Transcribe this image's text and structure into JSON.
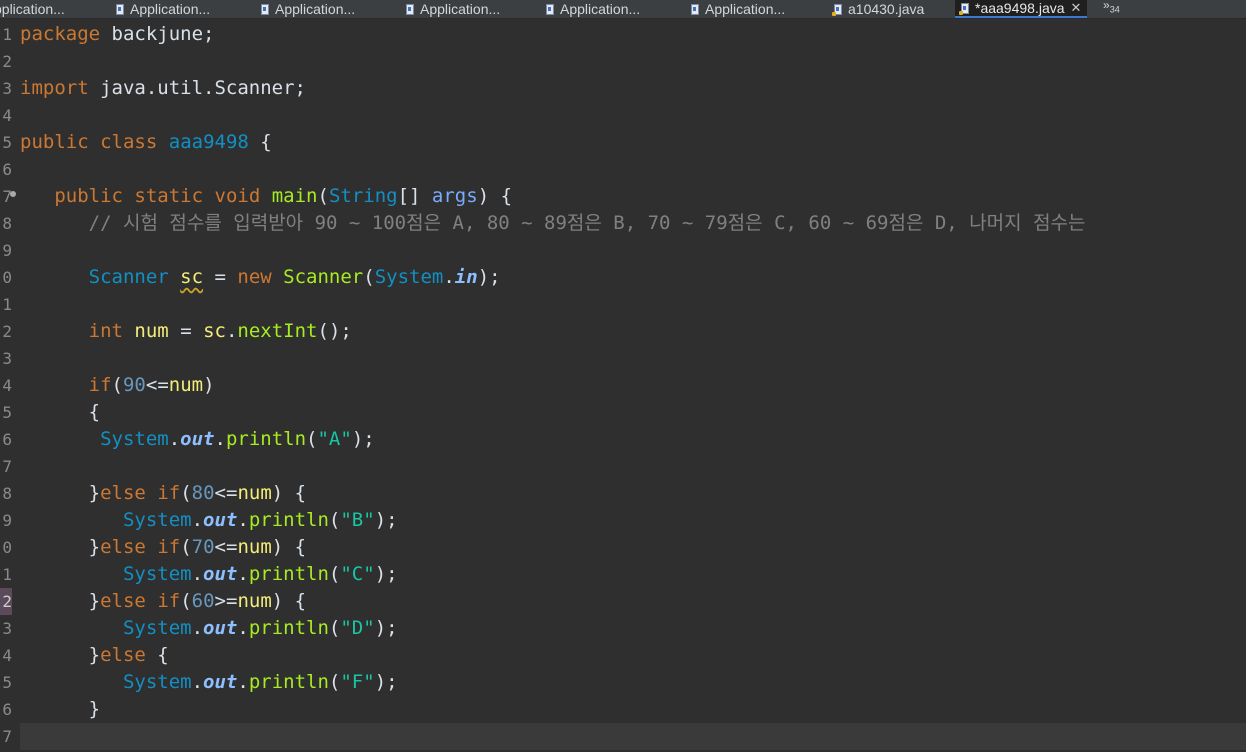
{
  "tabs": [
    {
      "label": "pplication...",
      "active": false,
      "icon": "java-file-icon"
    },
    {
      "label": "Application...",
      "active": false,
      "icon": "java-file-icon"
    },
    {
      "label": "Application...",
      "active": false,
      "icon": "java-file-icon"
    },
    {
      "label": "Application...",
      "active": false,
      "icon": "java-file-icon"
    },
    {
      "label": "Application...",
      "active": false,
      "icon": "java-file-icon"
    },
    {
      "label": "Application...",
      "active": false,
      "icon": "java-file-icon"
    },
    {
      "label": "a10430.java",
      "active": false,
      "icon": "java-file-warning-icon"
    },
    {
      "label": "*aaa9498.java",
      "active": true,
      "icon": "java-file-warning-icon",
      "close": "✕"
    }
  ],
  "overflow": {
    "chevron": "»",
    "count": "34"
  },
  "line_numbers": [
    "1",
    "2",
    "3",
    "4",
    "5",
    "6",
    "7",
    "8",
    "9",
    "0",
    "1",
    "2",
    "3",
    "4",
    "5",
    "6",
    "7",
    "8",
    "9",
    "0",
    "1",
    "2",
    "3",
    "4",
    "5",
    "6",
    "7"
  ],
  "code": {
    "l1_kw": "package",
    "l1_rest": " backjune;",
    "l3_kw": "import",
    "l3_rest": " java.util.Scanner;",
    "l5_kw1": "public",
    "l5_kw2": "class",
    "l5_name": "aaa9498",
    "l5_brace": " {",
    "l7_kw1": "public",
    "l7_kw2": "static",
    "l7_kw3": "void",
    "l7_method": "main",
    "l7_open": "(",
    "l7_type": "String",
    "l7_arr": "[] ",
    "l7_param": "args",
    "l7_close": ") {",
    "l8_comment": "// 시험 점수를 입력받아 90 ~ 100점은 A, 80 ~ 89점은 B, 70 ~ 79점은 C, 60 ~ 69점은 D, 나머지 점수는",
    "l10_type": "Scanner",
    "l10_var": "sc",
    "l10_eq": " = ",
    "l10_new": "new",
    "l10_cls": "Scanner",
    "l10_open": "(",
    "l10_sys": "System",
    "l10_dot": ".",
    "l10_in": "in",
    "l10_close": ");",
    "l12_kw": "int",
    "l12_var": "num",
    "l12_eq": " = ",
    "l12_obj": "sc",
    "l12_dot": ".",
    "l12_method": "nextInt",
    "l12_end": "();",
    "l14_kw": "if",
    "l14_open": "(",
    "l14_num": "90",
    "l14_op": "<=",
    "l14_var": "num",
    "l14_close": ")",
    "l15_brace": "{",
    "l16_sys": "System",
    "l16_dot1": ".",
    "l16_out": "out",
    "l16_dot2": ".",
    "l16_method": "println",
    "l16_open": "(",
    "l16_str": "\"A\"",
    "l16_close": ");",
    "l18_brace": "}",
    "l18_else": "else",
    "l18_if": "if",
    "l18_open": "(",
    "l18_num": "80",
    "l18_op": "<=",
    "l18_var": "num",
    "l18_close": ") {",
    "l19_sys": "System",
    "l19_out": "out",
    "l19_method": "println",
    "l19_str": "\"B\"",
    "l20_brace": "}",
    "l20_else": "else",
    "l20_if": "if",
    "l20_num": "70",
    "l20_op": "<=",
    "l20_var": "num",
    "l20_close": ") {",
    "l21_sys": "System",
    "l21_out": "out",
    "l21_method": "println",
    "l21_str": "\"C\"",
    "l22_brace": "}",
    "l22_else": "else",
    "l22_if": "if",
    "l22_num": "60",
    "l22_op": ">=",
    "l22_var": "num",
    "l22_close": ") {",
    "l23_sys": "System",
    "l23_out": "out",
    "l23_method": "println",
    "l23_str": "\"D\"",
    "l24_brace": "}",
    "l24_else": "else",
    "l24_close": " {",
    "l25_sys": "System",
    "l25_out": "out",
    "l25_method": "println",
    "l25_str": "\"F\"",
    "l26_brace": "}"
  },
  "colors": {
    "keyword": "#cc7832",
    "class": "#1290c3",
    "method": "#a7ec21",
    "field": "#8dbeff",
    "variable": "#f3ec79",
    "number": "#6897bb",
    "string": "#17c6a3",
    "comment": "#808080",
    "background": "#2f2f2f"
  }
}
